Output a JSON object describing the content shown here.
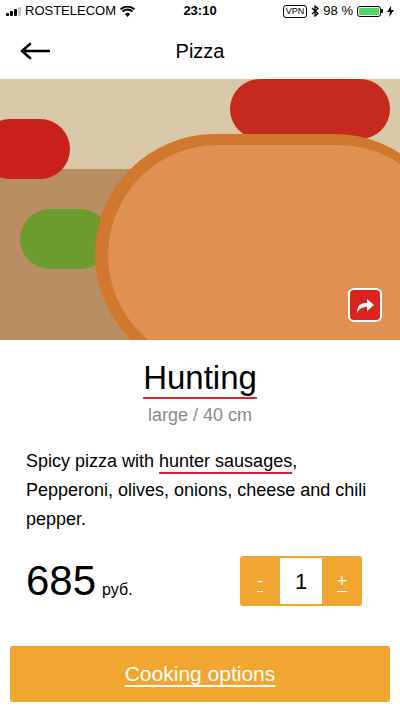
{
  "status_bar": {
    "carrier": "ROSTELECOM",
    "signal_level": 0.75,
    "time": "23:10",
    "vpn": "VPN",
    "battery_text": "98 %",
    "battery_level": 0.98,
    "charging": true
  },
  "nav": {
    "title": "Pizza"
  },
  "product": {
    "name": "Hunting",
    "name_underlined": true,
    "size": "large / 40 cm",
    "description": [
      {
        "text": "Spicy pizza with ",
        "underlined": false
      },
      {
        "text": "hunter sausages",
        "underlined": true
      },
      {
        "text": ", Pepperoni, olives, onions, cheese and chili pepper.",
        "underlined": false
      }
    ],
    "price": "685",
    "currency": "руб."
  },
  "quantity": {
    "decrement": "-",
    "value": "1",
    "increment": "+"
  },
  "button": "Cooking options"
}
